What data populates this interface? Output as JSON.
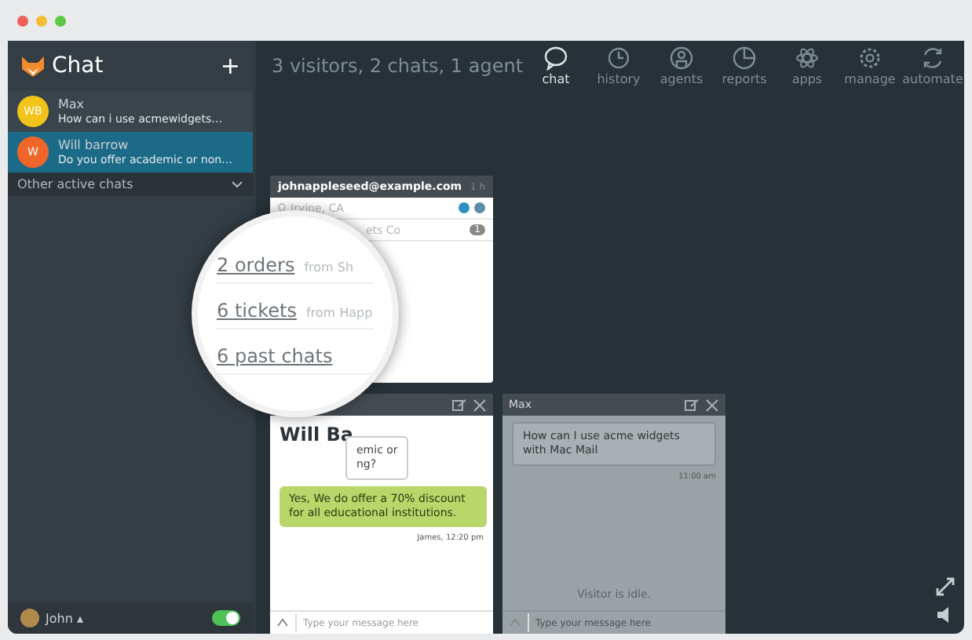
{
  "sidebar": {
    "title": "Chat",
    "add_label": "+",
    "chats": [
      {
        "name": "Max",
        "preview": "How can i use acmewidgets…",
        "initials": "WB",
        "color": "#f2c318",
        "selected": false
      },
      {
        "name": "Will barrow",
        "preview": "Do you offer academic or non…",
        "initials": "W",
        "color": "#f0652a",
        "selected": true
      }
    ],
    "section": "Other active chats",
    "agent": {
      "name": "John",
      "caret": "▴",
      "online": true
    }
  },
  "header": {
    "summary": "3 visitors, 2 chats, 1 agent",
    "nav": [
      {
        "label": "chat",
        "kind": "bubble",
        "selected": true
      },
      {
        "label": "history",
        "kind": "clock",
        "selected": false
      },
      {
        "label": "agents",
        "kind": "person",
        "selected": false
      },
      {
        "label": "reports",
        "kind": "pie",
        "selected": false
      },
      {
        "label": "apps",
        "kind": "atom",
        "selected": false
      },
      {
        "label": "manage",
        "kind": "gear",
        "selected": false
      },
      {
        "label": "automate",
        "kind": "cycle",
        "selected": false
      }
    ]
  },
  "visitor_card": {
    "email": "johnappleseed@example.com",
    "time": "1 h",
    "location": "Irvine, CA",
    "company": "ets Co",
    "badge": "1"
  },
  "magnifier": {
    "links": [
      {
        "link": "2 orders",
        "source": "from Sh"
      },
      {
        "link": "6 tickets",
        "source": "from Happ"
      },
      {
        "link": "6 past chats"
      }
    ]
  },
  "chats": [
    {
      "title": "Will Ba",
      "idle": false,
      "messages": [
        {
          "kind": "visitor",
          "text": "emic or\nng?"
        },
        {
          "kind": "agent",
          "text": "Yes, We do offer a 70% discount for all educational institutions.",
          "meta": "James, 12:20 pm"
        }
      ],
      "placeholder": "Type your message here"
    },
    {
      "title": "Max",
      "idle": true,
      "messages": [
        {
          "kind": "visitor",
          "text": "How can I use acme widgets with Mac Mail",
          "meta": "11:00 am"
        }
      ],
      "status": "Visitor is idle.",
      "placeholder": "Type your message here"
    }
  ]
}
